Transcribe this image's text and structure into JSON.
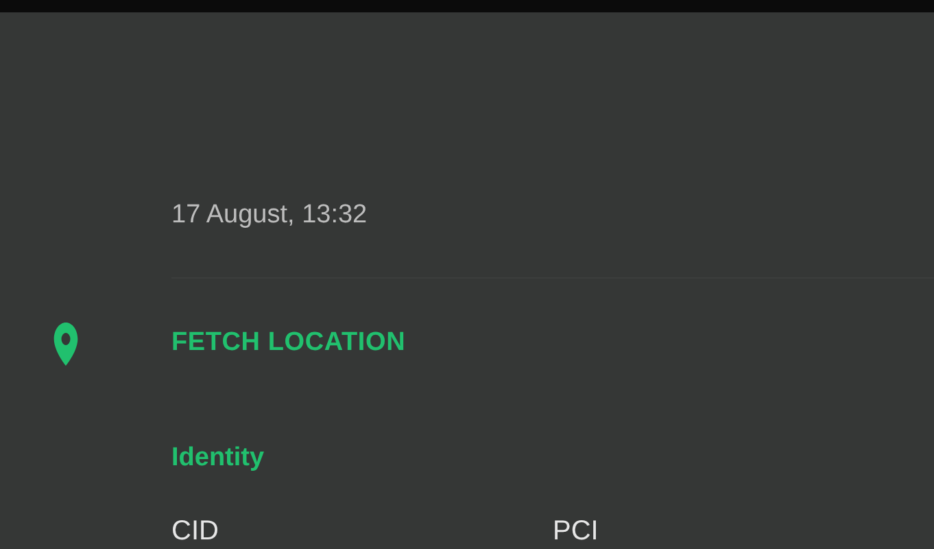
{
  "date": "17 August, 13:32",
  "action": {
    "label": "FETCH LOCATION"
  },
  "section": {
    "title": "Identity"
  },
  "fields": [
    {
      "label": "CID"
    },
    {
      "label": "PCI"
    }
  ]
}
